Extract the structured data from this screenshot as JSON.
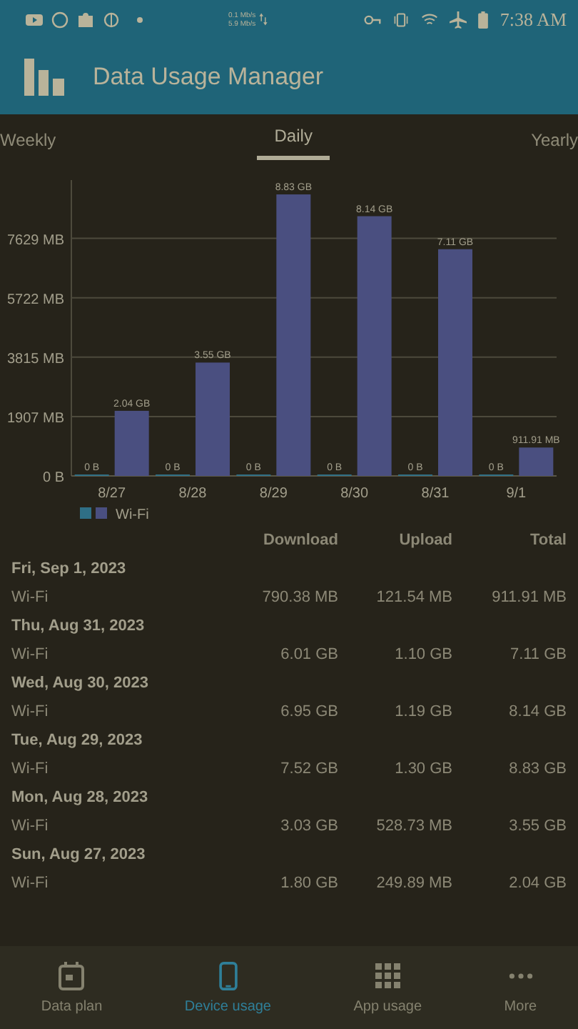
{
  "status_bar": {
    "speed_up": "0.1 Mb/s",
    "speed_down": "5.9 Mb/s",
    "time": "7:38 AM"
  },
  "app_bar": {
    "title": "Data Usage Manager"
  },
  "tabs": [
    {
      "label": "Weekly",
      "selected": false
    },
    {
      "label": "Daily",
      "selected": true
    },
    {
      "label": "Yearly",
      "selected": false
    }
  ],
  "chart_data": {
    "type": "bar",
    "categories": [
      "8/27",
      "8/28",
      "8/29",
      "8/30",
      "8/31",
      "9/1"
    ],
    "ylim": [
      0,
      9500
    ],
    "grid": true,
    "yticks": [
      {
        "value": 0,
        "label": "0 B"
      },
      {
        "value": 1907,
        "label": "1907 MB"
      },
      {
        "value": 3815,
        "label": "3815 MB"
      },
      {
        "value": 5722,
        "label": "5722 MB"
      },
      {
        "value": 7629,
        "label": "7629 MB"
      }
    ],
    "series": [
      {
        "color": "#2f6f86",
        "values": [
          0,
          0,
          0,
          0,
          0,
          0
        ]
      },
      {
        "name": "Wi-Fi",
        "color": "#4a4f80",
        "values": [
          2090,
          3640,
          9040,
          8340,
          7280,
          912
        ]
      }
    ]
  },
  "bar_labels": [
    [
      "0 B",
      "0 B",
      "0 B",
      "0 B",
      "0 B",
      "0 B"
    ],
    [
      "2.04 GB",
      "3.55 GB",
      "8.83 GB",
      "8.14 GB",
      "7.11 GB",
      "911.91 MB"
    ]
  ],
  "table": {
    "columns": [
      "Download",
      "Upload",
      "Total"
    ],
    "days": [
      {
        "date": "Fri, Sep 1, 2023",
        "rows": [
          {
            "name": "Wi-Fi",
            "download": "790.38 MB",
            "upload": "121.54 MB",
            "total": "911.91 MB"
          }
        ]
      },
      {
        "date": "Thu, Aug 31, 2023",
        "rows": [
          {
            "name": "Wi-Fi",
            "download": "6.01 GB",
            "upload": "1.10 GB",
            "total": "7.11 GB"
          }
        ]
      },
      {
        "date": "Wed, Aug 30, 2023",
        "rows": [
          {
            "name": "Wi-Fi",
            "download": "6.95 GB",
            "upload": "1.19 GB",
            "total": "8.14 GB"
          }
        ]
      },
      {
        "date": "Tue, Aug 29, 2023",
        "rows": [
          {
            "name": "Wi-Fi",
            "download": "7.52 GB",
            "upload": "1.30 GB",
            "total": "8.83 GB"
          }
        ]
      },
      {
        "date": "Mon, Aug 28, 2023",
        "rows": [
          {
            "name": "Wi-Fi",
            "download": "3.03 GB",
            "upload": "528.73 MB",
            "total": "3.55 GB"
          }
        ]
      },
      {
        "date": "Sun, Aug 27, 2023",
        "rows": [
          {
            "name": "Wi-Fi",
            "download": "1.80 GB",
            "upload": "249.89 MB",
            "total": "2.04 GB"
          }
        ]
      }
    ]
  },
  "bottom_nav": [
    {
      "label": "Data plan",
      "selected": false
    },
    {
      "label": "Device usage",
      "selected": true
    },
    {
      "label": "App usage",
      "selected": false
    },
    {
      "label": "More",
      "selected": false
    }
  ]
}
